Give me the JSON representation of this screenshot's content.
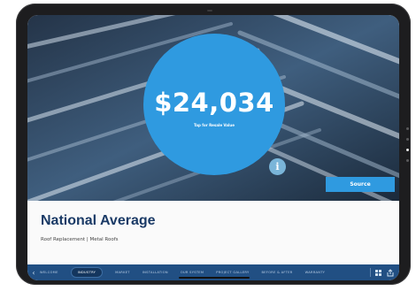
{
  "hero": {
    "price": "$24,034",
    "tap_hint": "Tap for Resale Value",
    "info_icon": "info-icon",
    "source_label": "Source"
  },
  "content": {
    "title": "National Average",
    "subtitle": "Roof Replacement | Metal Roofs"
  },
  "nav": {
    "back_icon": "chevron-left-icon",
    "items": [
      "WELCOME",
      "INDUSTRY",
      "MARKET",
      "INSTALLATION",
      "OUR SYSTEM",
      "PROJECT GALLERY",
      "BEFORE & AFTER",
      "WARRANTY"
    ],
    "active_index": 1,
    "grid_icon": "grid-icon",
    "share_icon": "share-icon"
  },
  "colors": {
    "accent": "#2f9ae0",
    "nav_bg": "#214f83",
    "title": "#1a3a66"
  }
}
